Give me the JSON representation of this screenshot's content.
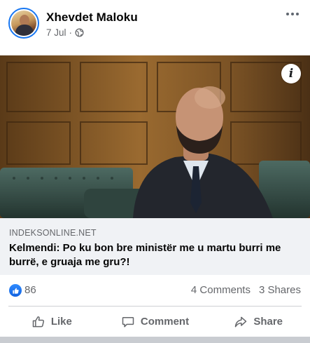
{
  "post": {
    "author_name": "Xhevdet Maloku",
    "date": "7 Jul",
    "separator": "·",
    "audience_icon": "globe-icon",
    "more_icon": "more-options-icon"
  },
  "link": {
    "info_label": "i",
    "domain": "INDEKSONLINE.NET",
    "headline": "Kelmendi: Po ku bon bre ministër me u martu burri me burrë, e gruaja me gru?!"
  },
  "stats": {
    "reaction_icon": "like-reaction-icon",
    "reaction_count": "86",
    "comments": "4 Comments",
    "shares": "3 Shares"
  },
  "actions": {
    "like": "Like",
    "comment": "Comment",
    "share": "Share"
  },
  "colors": {
    "accent": "#1877f2",
    "secondary_text": "#65676b",
    "caption_background": "#f0f2f5"
  }
}
